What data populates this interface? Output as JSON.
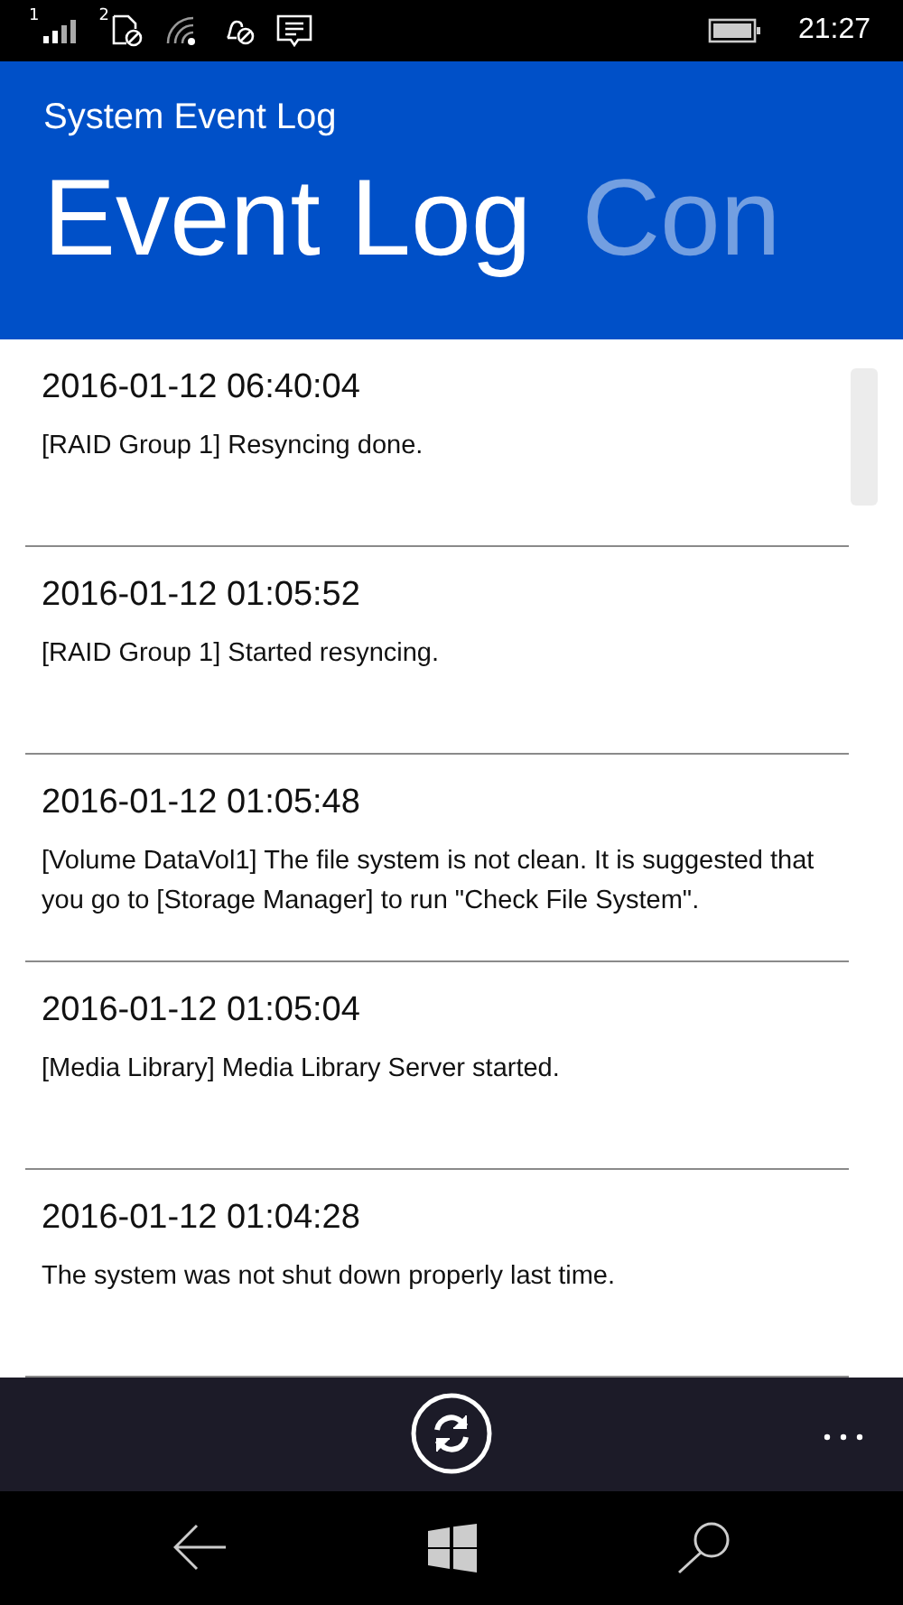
{
  "status_bar": {
    "sim_1": "1",
    "sim_2": "2",
    "time": "21:27"
  },
  "app_title": "System Event Log",
  "pivot": [
    {
      "label": "Event Log",
      "selected": true
    },
    {
      "label": "Con",
      "selected": false
    }
  ],
  "events": [
    {
      "time": "2016-01-12 06:40:04",
      "message": "[RAID Group 1] Resyncing done."
    },
    {
      "time": "2016-01-12 01:05:52",
      "message": "[RAID Group 1] Started resyncing."
    },
    {
      "time": "2016-01-12 01:05:48",
      "message": "[Volume DataVol1] The file system is not clean. It is suggested that you go to [Storage Manager] to run \"Check File System\"."
    },
    {
      "time": "2016-01-12 01:05:04",
      "message": "[Media Library] Media Library Server started."
    },
    {
      "time": "2016-01-12 01:04:28",
      "message": "The system was not shut down properly last time."
    }
  ]
}
